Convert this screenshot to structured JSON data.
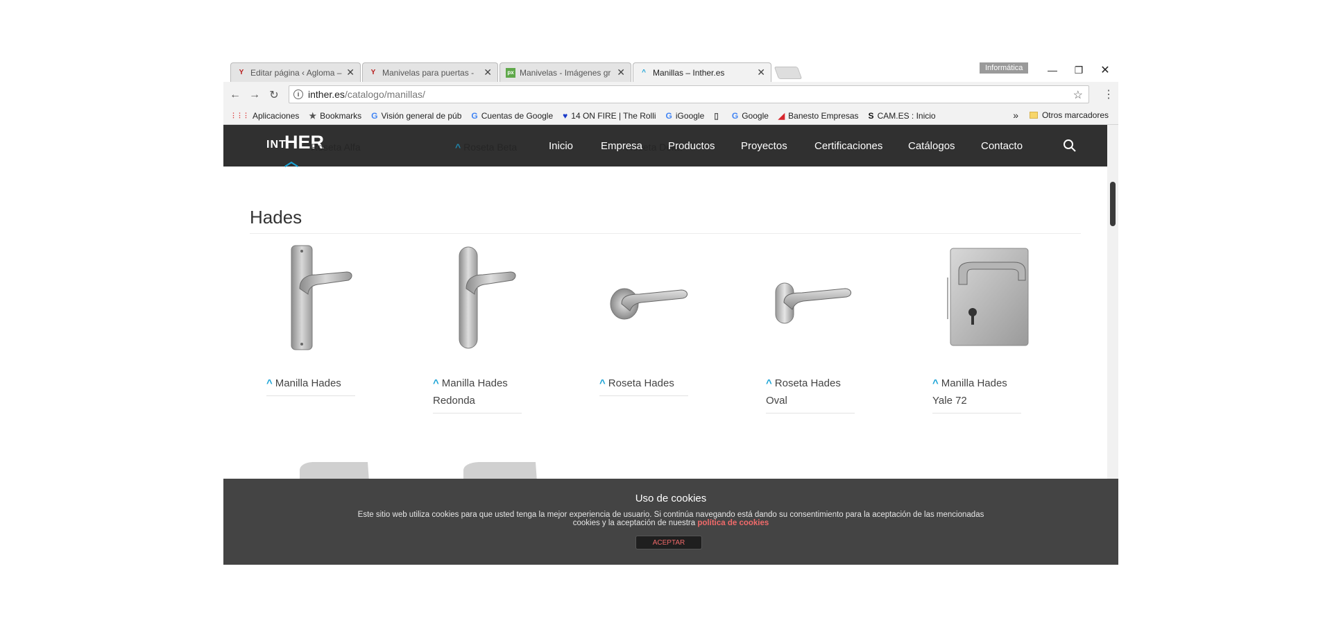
{
  "browser": {
    "tabs": [
      {
        "title": "Editar página ‹ Agloma –",
        "favicon": "Y",
        "favicon_color": "#b71c1c"
      },
      {
        "title": "Manivelas para puertas -",
        "favicon": "Y",
        "favicon_color": "#b71c1c"
      },
      {
        "title": "Manivelas - Imágenes gr",
        "favicon": "px",
        "favicon_color": "#5fa84a"
      },
      {
        "title": "Manillas – Inther.es",
        "favicon": "^",
        "favicon_color": "#1aa3d6"
      }
    ],
    "profile_label": "Informática",
    "url_host": "inther.es",
    "url_path": "/catalogo/manillas/",
    "bookmarks": [
      {
        "label": "Aplicaciones",
        "icon": "⋮⋮⋮",
        "color": "#d33"
      },
      {
        "label": "Bookmarks",
        "icon": "★",
        "color": "#555"
      },
      {
        "label": "Visión general de púb",
        "icon": "G",
        "color": "#4285f4"
      },
      {
        "label": "Cuentas de Google",
        "icon": "G",
        "color": "#4285f4"
      },
      {
        "label": "14 ON FIRE | The Rolli",
        "icon": "♥",
        "color": "#1a3bc8"
      },
      {
        "label": "iGoogle",
        "icon": "G",
        "color": "#4285f4"
      },
      {
        "label": "",
        "icon": "▯",
        "color": "#555"
      },
      {
        "label": "Google",
        "icon": "G",
        "color": "#4285f4"
      },
      {
        "label": "Banesto Empresas",
        "icon": "◢",
        "color": "#d7262d"
      },
      {
        "label": "CAM.ES : Inicio",
        "icon": "S",
        "color": "#111"
      }
    ],
    "more_bookmarks": "»",
    "other_bookmarks": "Otros marcadores"
  },
  "site": {
    "logo_int": "INT",
    "logo_her": "HER",
    "ghost_items": [
      "Roseta Alfa",
      "Roseta Beta",
      "Roseta Delta"
    ],
    "nav": [
      "Inicio",
      "Empresa",
      "Productos",
      "Proyectos",
      "Certificaciones",
      "Catálogos",
      "Contacto"
    ],
    "section_title": "Hades",
    "products": [
      {
        "name": "Manilla Hades",
        "shape": "plate-long"
      },
      {
        "name": "Manilla Hades Redonda",
        "shape": "plate-round"
      },
      {
        "name": "Roseta Hades",
        "shape": "rose-round"
      },
      {
        "name": "Roseta Hades Oval",
        "shape": "rose-oval"
      },
      {
        "name": "Manilla Hades Yale 72",
        "shape": "plate-square"
      }
    ]
  },
  "cookie": {
    "title": "Uso de cookies",
    "text": "Este sitio web utiliza cookies para que usted tenga la mejor experiencia de usuario. Si continúa navegando está dando su consentimiento para la aceptación de las mencionadas cookies y la aceptación de nuestra",
    "link": "política de cookies",
    "accept": "ACEPTAR"
  }
}
